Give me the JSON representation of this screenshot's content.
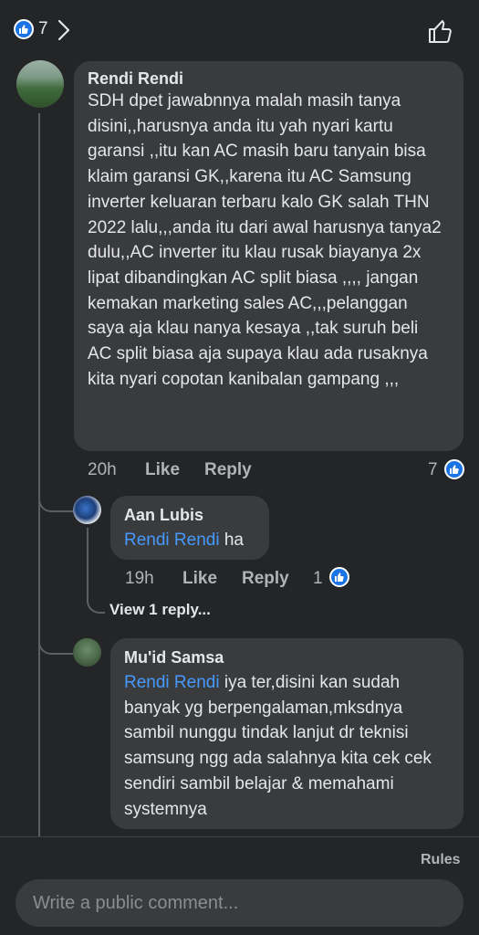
{
  "header": {
    "like_count": "7",
    "icons": {
      "like_badge": "thumbs-up-icon",
      "chevron": "chevron-right-icon",
      "like_button": "thumbs-up-outline-icon"
    }
  },
  "comments": [
    {
      "author": "Rendi Rendi",
      "text": "SDH dpet jawabnnya malah masih tanya disini,,harusnya anda itu yah nyari kartu garansi ,,itu kan AC masih baru tanyain bisa klaim garansi GK,,karena itu AC Samsung inverter keluaran terbaru kalo GK salah THN 2022 lalu,,,anda itu dari awal harusnya tanya2 dulu,,AC inverter itu klau rusak biayanya 2x lipat dibandingkan AC split biasa ,,,, jangan kemakan marketing sales AC,,,pelanggan saya aja klau nanya kesaya ,,tak suruh beli AC split biasa aja supaya klau ada rusaknya kita nyari copotan kanibalan gampang ,,,",
      "time": "20h",
      "like_label": "Like",
      "reply_label": "Reply",
      "reactions": "7"
    }
  ],
  "replies": [
    {
      "author": "Aan Lubis",
      "mention": "Rendi Rendi",
      "text": "ha",
      "time": "19h",
      "like_label": "Like",
      "reply_label": "Reply",
      "reactions": "1",
      "view_replies": "View 1 reply..."
    },
    {
      "author": "Mu'id Samsa",
      "mention": "Rendi Rendi",
      "text": "iya ter,disini kan sudah banyak yg berpengalaman,mksdnya sambil nunggu tindak lanjut dr teknisi samsung ngg ada salahnya kita cek cek sendiri sambil belajar & memahami systemnya"
    }
  ],
  "footer": {
    "rules_label": "Rules",
    "composer_placeholder": "Write a public comment..."
  },
  "colors": {
    "background": "#242526",
    "bubble": "#3a3b3c",
    "accent": "#1b74e4",
    "mention": "#4599ff"
  }
}
